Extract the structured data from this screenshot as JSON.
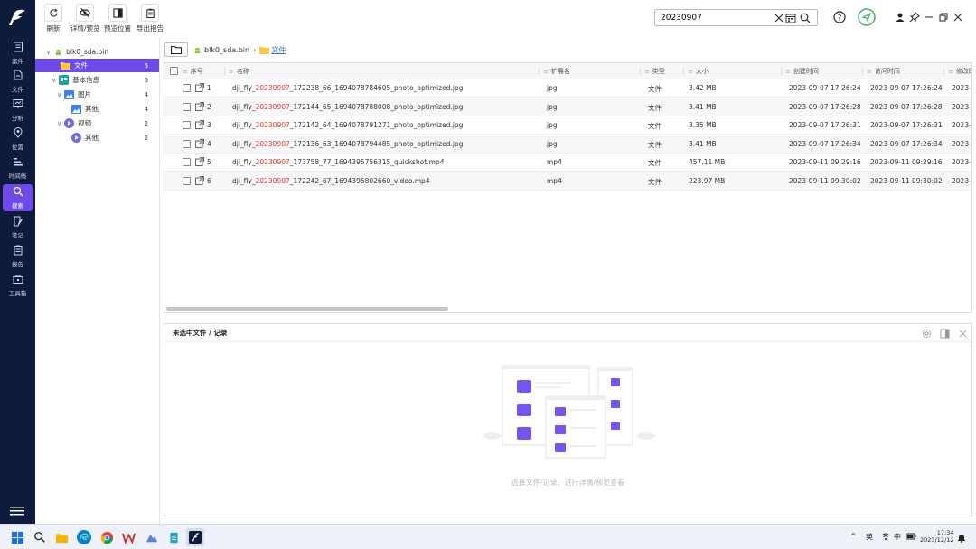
{
  "nav": {
    "items": [
      {
        "label": "案件",
        "icon": "case-icon"
      },
      {
        "label": "文件",
        "icon": "file-icon"
      },
      {
        "label": "分析",
        "icon": "analysis-icon"
      },
      {
        "label": "位置",
        "icon": "location-icon"
      },
      {
        "label": "时间线",
        "icon": "timeline-icon"
      },
      {
        "label": "搜索",
        "icon": "search-icon",
        "active": true
      },
      {
        "label": "笔记",
        "icon": "note-icon"
      },
      {
        "label": "报告",
        "icon": "report-icon"
      },
      {
        "label": "工具箱",
        "icon": "toolbox-icon"
      }
    ],
    "accent": "#6c4be8",
    "bg": "#0f1b3d"
  },
  "toolbar": {
    "refresh": "刷新",
    "detail_preview": "详情/预览",
    "preview_position": "预览位置",
    "export_report": "导出报告",
    "search_value": "20230907"
  },
  "tree": {
    "root": "blk0_sda.bin",
    "nodes": [
      {
        "label": "文件",
        "count": "6",
        "selected": true
      },
      {
        "label": "基本信息",
        "count": "6"
      },
      {
        "label": "图片",
        "count": "4"
      },
      {
        "label": "其他",
        "count": "4"
      },
      {
        "label": "视频",
        "count": "2"
      },
      {
        "label": "其他",
        "count": "2"
      }
    ]
  },
  "breadcrumb": {
    "device": "blk0_sda.bin",
    "folder": "文件"
  },
  "table": {
    "headers": {
      "index": "序号",
      "name": "名称",
      "ext": "扩展名",
      "type": "类型",
      "size": "大小",
      "created": "创建时间",
      "accessed": "访问时间",
      "modified": "修改时"
    },
    "rows": [
      {
        "idx": "1",
        "pre": "dji_fly_",
        "hl": "20230907",
        "post": "_172238_66_1694078784605_photo_optimized.jpg",
        "ext": "jpg",
        "type": "文件",
        "size": "3.42 MB",
        "created": "2023-09-07 17:26:24",
        "accessed": "2023-09-07 17:26:24",
        "modified": "2023-0"
      },
      {
        "idx": "2",
        "pre": "dji_fly_",
        "hl": "20230907",
        "post": "_172144_65_1694078788008_photo_optimized.jpg",
        "ext": "jpg",
        "type": "文件",
        "size": "3.41 MB",
        "created": "2023-09-07 17:26:28",
        "accessed": "2023-09-07 17:26:28",
        "modified": "2023-0"
      },
      {
        "idx": "3",
        "pre": "dji_fly_",
        "hl": "20230907",
        "post": "_172142_64_1694078791271_photo_optimized.jpg",
        "ext": "jpg",
        "type": "文件",
        "size": "3.35 MB",
        "created": "2023-09-07 17:26:31",
        "accessed": "2023-09-07 17:26:31",
        "modified": "2023-0"
      },
      {
        "idx": "4",
        "pre": "dji_fly_",
        "hl": "20230907",
        "post": "_172136_63_1694078794485_photo_optimized.jpg",
        "ext": "jpg",
        "type": "文件",
        "size": "3.41 MB",
        "created": "2023-09-07 17:26:34",
        "accessed": "2023-09-07 17:26:34",
        "modified": "2023-0"
      },
      {
        "idx": "5",
        "pre": "dji_fly_",
        "hl": "20230907",
        "post": "_173758_77_1694395756315_quickshot.mp4",
        "ext": "mp4",
        "type": "文件",
        "size": "457.11 MB",
        "created": "2023-09-11 09:29:16",
        "accessed": "2023-09-11 09:29:16",
        "modified": "2023-0"
      },
      {
        "idx": "6",
        "pre": "dji_fly_",
        "hl": "20230907",
        "post": "_172242_67_1694395802660_video.mp4",
        "ext": "mp4",
        "type": "文件",
        "size": "223.97 MB",
        "created": "2023-09-11 09:30:02",
        "accessed": "2023-09-11 09:30:02",
        "modified": "2023-0"
      }
    ]
  },
  "preview": {
    "title": "未选中文件 / 记录",
    "hint": "选择文件/记录，进行详情/预览查看"
  },
  "taskbar": {
    "ime": "英",
    "ime2": "中",
    "time": "17:34",
    "date": "2023/12/12"
  }
}
